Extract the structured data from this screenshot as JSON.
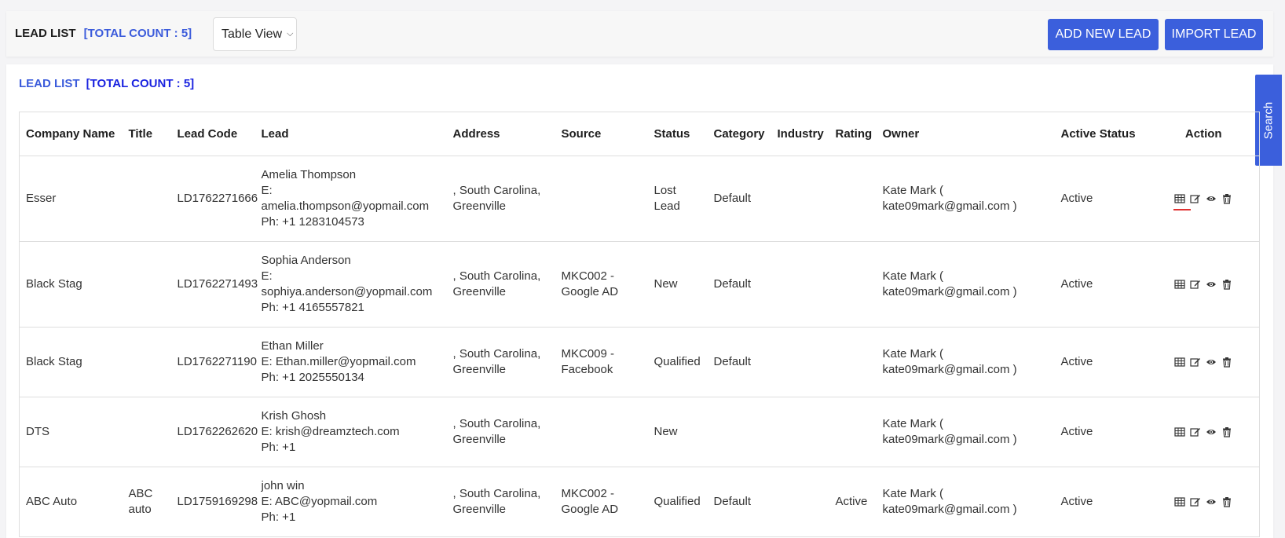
{
  "header": {
    "title": "LEAD LIST",
    "count_label": "[TOTAL COUNT : 5]",
    "view_select": {
      "selected": "Table View"
    },
    "add_button": "ADD NEW LEAD",
    "import_button": "IMPORT LEAD"
  },
  "card": {
    "title": "LEAD LIST",
    "count_label": "[TOTAL COUNT : 5]"
  },
  "search_tab": "Search",
  "table": {
    "columns": [
      "Company Name",
      "Title",
      "Lead Code",
      "Lead",
      "Address",
      "Source",
      "Status",
      "Category",
      "Industry",
      "Rating",
      "Owner",
      "Active Status",
      "Action"
    ],
    "rows": [
      {
        "company": "Esser",
        "title": "",
        "lead_code": "LD1762271666",
        "lead_name": "Amelia Thompson",
        "lead_email_1": "E:",
        "lead_email_2": "amelia.thompson@yopmail.com",
        "lead_phone": "Ph: +1 1283104573",
        "address_1": ", South Carolina,",
        "address_2": "Greenville",
        "source_1": "",
        "source_2": "",
        "status_1": "Lost",
        "status_2": "Lead",
        "category": "Default",
        "industry": "",
        "rating": "",
        "owner_1": "Kate Mark (",
        "owner_2": "kate09mark@gmail.com )",
        "active_status": "Active"
      },
      {
        "company": "Black Stag",
        "title": "",
        "lead_code": "LD1762271493",
        "lead_name": "Sophia Anderson",
        "lead_email_1": "E:",
        "lead_email_2": "sophiya.anderson@yopmail.com",
        "lead_phone": "Ph: +1 4165557821",
        "address_1": ", South Carolina,",
        "address_2": "Greenville",
        "source_1": "MKC002 -",
        "source_2": "Google AD",
        "status_1": "New",
        "status_2": "",
        "category": "Default",
        "industry": "",
        "rating": "",
        "owner_1": "Kate Mark (",
        "owner_2": "kate09mark@gmail.com )",
        "active_status": "Active"
      },
      {
        "company": "Black Stag",
        "title": "",
        "lead_code": "LD1762271190",
        "lead_name": "Ethan Miller",
        "lead_email_1": "E: Ethan.miller@yopmail.com",
        "lead_email_2": "",
        "lead_phone": "Ph: +1 2025550134",
        "address_1": ", South Carolina,",
        "address_2": "Greenville",
        "source_1": "MKC009 -",
        "source_2": "Facebook",
        "status_1": "Qualified",
        "status_2": "",
        "category": "Default",
        "industry": "",
        "rating": "",
        "owner_1": "Kate Mark (",
        "owner_2": "kate09mark@gmail.com )",
        "active_status": "Active"
      },
      {
        "company": "DTS",
        "title": "",
        "lead_code": "LD1762262620",
        "lead_name": "Krish Ghosh",
        "lead_email_1": "E: krish@dreamztech.com",
        "lead_email_2": "",
        "lead_phone": "Ph: +1",
        "address_1": ", South Carolina,",
        "address_2": "Greenville",
        "source_1": "",
        "source_2": "",
        "status_1": "New",
        "status_2": "",
        "category": "",
        "industry": "",
        "rating": "",
        "owner_1": "Kate Mark (",
        "owner_2": "kate09mark@gmail.com )",
        "active_status": "Active"
      },
      {
        "company": "ABC Auto",
        "title_1": "ABC",
        "title_2": "auto",
        "lead_code": "LD1759169298",
        "lead_name": "john win",
        "lead_email_1": "E: ABC@yopmail.com",
        "lead_email_2": "",
        "lead_phone": "Ph: +1",
        "address_1": ", South Carolina,",
        "address_2": "Greenville",
        "source_1": "MKC002 -",
        "source_2": "Google AD",
        "status_1": "Qualified",
        "status_2": "",
        "category": "Default",
        "industry": "",
        "rating": "Active",
        "owner_1": "Kate Mark (",
        "owner_2": "kate09mark@gmail.com )",
        "active_status": "Active"
      }
    ]
  },
  "action_icons": [
    "table-icon",
    "edit-icon",
    "view-eye-icon",
    "delete-trash-icon"
  ],
  "colors": {
    "primary": "#3b5fdc",
    "count_blue": "#3b5bdb",
    "count_dark_blue": "#1a23e0",
    "underline_red": "#e03131"
  }
}
